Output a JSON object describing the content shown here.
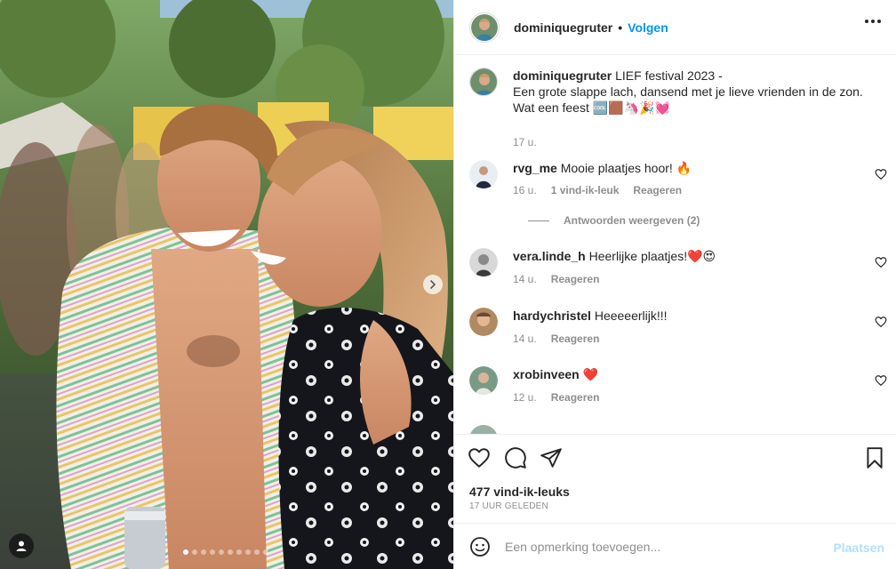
{
  "post": {
    "username": "dominiquegruter",
    "follow_label": "Volgen",
    "separator": "•",
    "caption_head": "LIEF festival 2023 -",
    "caption_body": "Een grote slappe lach, dansend met je lieve vrienden in de zon. Wat een feest 🆒🟫🦄🎉💓",
    "caption_time": "17 u.",
    "carousel_total": 10,
    "carousel_active": 1
  },
  "comments": [
    {
      "username": "rvg_me",
      "text": "Mooie plaatjes hoor! 🔥",
      "time": "16 u.",
      "likes": "1 vind-ik-leuk",
      "reply_label": "Reageren",
      "view_replies": "Antwoorden weergeven (2)"
    },
    {
      "username": "vera.linde_h",
      "text": "Heerlijke plaatjes!❤️😍",
      "time": "14 u.",
      "reply_label": "Reageren"
    },
    {
      "username": "hardychristel",
      "text": "Heeeeerlijk!!!",
      "time": "14 u.",
      "reply_label": "Reageren"
    },
    {
      "username": "xrobinveen",
      "text": "❤️",
      "time": "12 u.",
      "reply_label": "Reageren"
    }
  ],
  "actions": {
    "icons": [
      "heart-icon",
      "comment-icon",
      "share-icon",
      "bookmark-icon"
    ],
    "likes_count": "477 vind-ik-leuks",
    "time_ago": "17 UUR GELEDEN"
  },
  "composer": {
    "emoji_icon": "smiley-icon",
    "placeholder": "Een opmerking toevoegen...",
    "post_label": "Plaatsen"
  },
  "colors": {
    "accent": "#0095f6",
    "post_disabled": "#b2dffc",
    "muted": "#8e8e8e",
    "text": "#262626",
    "heart_red": "#ed4956"
  }
}
